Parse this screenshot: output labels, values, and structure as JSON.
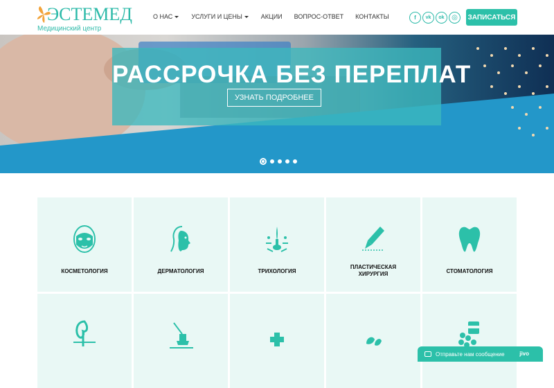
{
  "header": {
    "logo_word": "ЭСТЕМЕД",
    "logo_sub": "Медицинский центр",
    "nav": [
      {
        "label": "О НАС",
        "dropdown": true
      },
      {
        "label": "УСЛУГИ И ЦЕНЫ",
        "dropdown": true
      },
      {
        "label": "АКЦИИ",
        "dropdown": false
      },
      {
        "label": "ВОПРОС-ОТВЕТ",
        "dropdown": false
      },
      {
        "label": "КОНТАКТЫ",
        "dropdown": false
      }
    ],
    "socials": [
      {
        "name": "facebook-icon",
        "glyph": "f"
      },
      {
        "name": "vk-icon",
        "glyph": "vk"
      },
      {
        "name": "odnoklassniki-icon",
        "glyph": "ok"
      },
      {
        "name": "instagram-icon",
        "glyph": "◎"
      }
    ],
    "signup_label": "ЗАПИСАТЬСЯ"
  },
  "banner": {
    "title": "РАССРОЧКА БЕЗ ПЕРЕПЛАТ",
    "button_label": "УЗНАТЬ ПОДРОБНЕЕ",
    "slides": 5,
    "active_slide": 1
  },
  "services": [
    {
      "label": "КОСМЕТОЛОГИЯ",
      "icon": "face-mask-icon"
    },
    {
      "label": "ДЕРМАТОЛОГИЯ",
      "icon": "woman-profile-icon"
    },
    {
      "label": "ТРИХОЛОГИЯ",
      "icon": "hair-follicle-icon"
    },
    {
      "label": "ПЛАСТИЧЕСКАЯ ХИРУРГИЯ",
      "icon": "scalpel-icon"
    },
    {
      "label": "СТОМАТОЛОГИЯ",
      "icon": "tooth-icon"
    },
    {
      "label": "",
      "icon": "kidney-icon"
    },
    {
      "label": "",
      "icon": "ultrasound-icon"
    },
    {
      "label": "",
      "icon": "medical-cross-icon"
    },
    {
      "label": "",
      "icon": "leaves-icon"
    },
    {
      "label": "",
      "icon": "pills-jar-icon"
    }
  ],
  "chat": {
    "text": "Отправьте нам сообщение",
    "brand": "jivo"
  },
  "colors": {
    "accent": "#2cc0a9",
    "tile_bg": "#e9f8f5",
    "banner_panel": "#3cb9be"
  }
}
